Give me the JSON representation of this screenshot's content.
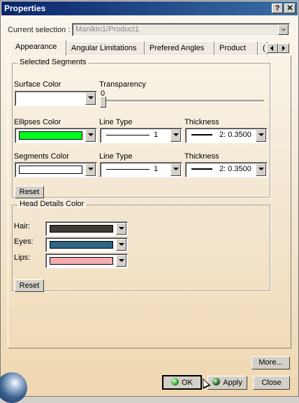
{
  "window": {
    "title": "Properties",
    "help_label": "?",
    "close_label": "✕"
  },
  "current_selection": {
    "label": "Current selection :",
    "value": "Manikin1/Product1"
  },
  "tabs": [
    {
      "label": "Appearance",
      "active": true
    },
    {
      "label": "Angular Limitations",
      "active": false
    },
    {
      "label": "Prefered Angles",
      "active": false
    },
    {
      "label": "Product",
      "active": false
    },
    {
      "label": "(",
      "active": false
    }
  ],
  "selected_segments": {
    "legend": "Selected Segments",
    "surface_color_label": "Surface Color",
    "surface_color": "#ffffff",
    "transparency_label": "Transparency",
    "transparency_value": "0",
    "ellipses_color_label": "Ellipses Color",
    "ellipses_color": "#00ff1e",
    "ellipses_line_type_label": "Line Type",
    "ellipses_line_type": "1",
    "ellipses_thickness_label": "Thickness",
    "ellipses_thickness": "2: 0.3500",
    "segments_color_label": "Segments Color",
    "segments_color": "#ffffff",
    "segments_line_type_label": "Line Type",
    "segments_line_type": "1",
    "segments_thickness_label": "Thickness",
    "segments_thickness": "2: 0.3500",
    "reset_label": "Reset"
  },
  "head_details": {
    "legend": "Head Details Color",
    "hair_label": "Hair:",
    "hair_color": "#403a30",
    "eyes_label": "Eyes:",
    "eyes_color": "#2f6582",
    "lips_label": "Lips:",
    "lips_color": "#f4aeb0",
    "reset_label": "Reset"
  },
  "footer": {
    "more_label": "More...",
    "ok_label": "OK",
    "apply_label": "Apply",
    "close_label": "Close"
  }
}
